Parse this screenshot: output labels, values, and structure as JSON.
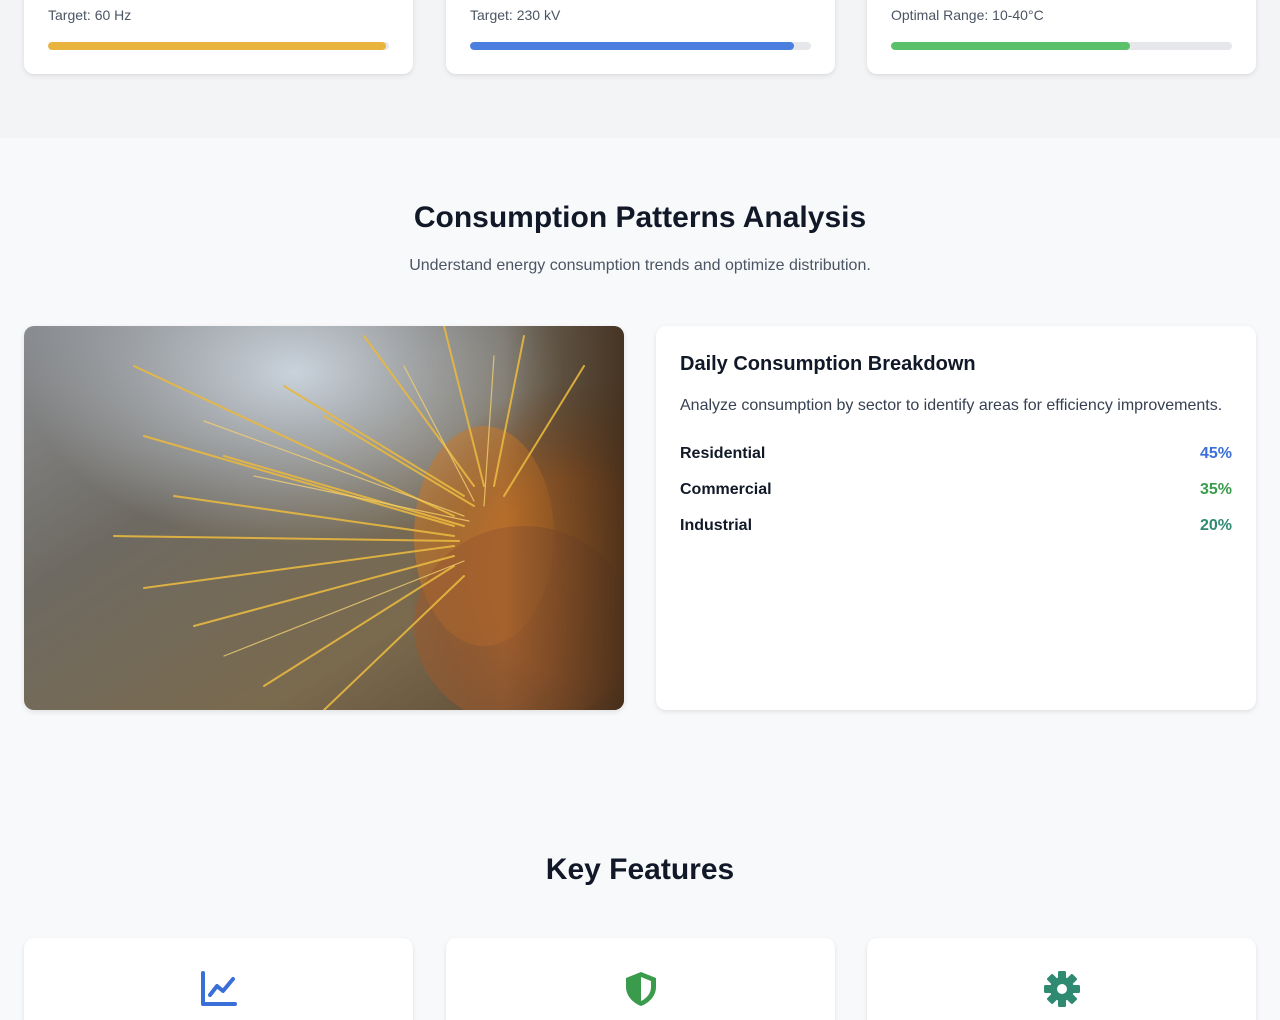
{
  "metrics": [
    {
      "target": "Target: 60 Hz",
      "progress": 0.99,
      "color": "#e9b43d"
    },
    {
      "target": "Target: 230 kV",
      "progress": 0.95,
      "color": "#4a7fe0"
    },
    {
      "target": "Optimal Range: 10-40°C",
      "progress": 0.7,
      "color": "#5ac16a"
    }
  ],
  "consumption": {
    "title": "Consumption Patterns Analysis",
    "subtitle": "Understand energy consumption trends and optimize distribution.",
    "card": {
      "title": "Daily Consumption Breakdown",
      "description": "Analyze consumption by sector to identify areas for efficiency improvements.",
      "sectors": [
        {
          "name": "Residential",
          "value": "45%",
          "color": "#3b6fd8"
        },
        {
          "name": "Commercial",
          "value": "35%",
          "color": "#3a9b4c"
        },
        {
          "name": "Industrial",
          "value": "20%",
          "color": "#2f8a72"
        }
      ]
    }
  },
  "features": {
    "title": "Key Features",
    "items": [
      {
        "icon": "chart-line-icon",
        "color": "#3b6fd8"
      },
      {
        "icon": "shield-icon",
        "color": "#3a9b4c"
      },
      {
        "icon": "gear-icon",
        "color": "#2f8a72"
      }
    ]
  }
}
